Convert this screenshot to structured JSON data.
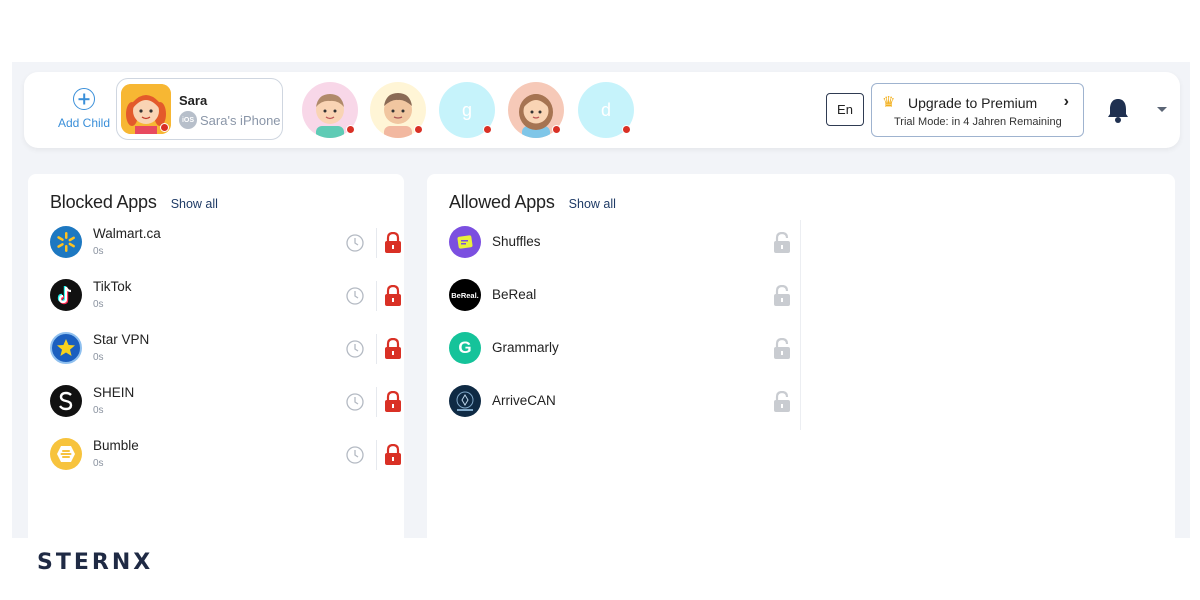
{
  "topbar": {
    "add_child_label": "Add Child",
    "active_child": {
      "name": "Sara",
      "device_badge": "iOS",
      "device": "Sara's iPhone"
    },
    "children": [
      {
        "initial": "",
        "color": "#f8d7e8",
        "kind": "boy"
      },
      {
        "initial": "",
        "color": "#fff5d6",
        "kind": "man"
      },
      {
        "initial": "g",
        "color": "#c6f3fb",
        "kind": "letter"
      },
      {
        "initial": "",
        "color": "#f6c9b8",
        "kind": "girl"
      },
      {
        "initial": "d",
        "color": "#c6f3fb",
        "kind": "letter"
      }
    ],
    "language": "En",
    "premium": {
      "title": "Upgrade to Premium",
      "subtitle": "Trial Mode: in 4 Jahren Remaining"
    }
  },
  "blocked": {
    "title": "Blocked Apps",
    "show_all": "Show all",
    "apps": [
      {
        "name": "Walmart.ca",
        "time": "0s",
        "icon": "walmart-icon"
      },
      {
        "name": "TikTok",
        "time": "0s",
        "icon": "tiktok-icon"
      },
      {
        "name": "Star VPN",
        "time": "0s",
        "icon": "star-vpn-icon"
      },
      {
        "name": "SHEIN",
        "time": "0s",
        "icon": "shein-icon"
      },
      {
        "name": "Bumble",
        "time": "0s",
        "icon": "bumble-icon"
      }
    ]
  },
  "allowed": {
    "title": "Allowed Apps",
    "show_all": "Show all",
    "apps": [
      {
        "name": "Shuffles",
        "icon": "shuffles-icon"
      },
      {
        "name": "BeReal",
        "icon": "bereal-icon",
        "icon_text": "BeReal."
      },
      {
        "name": "Grammarly",
        "icon": "grammarly-icon",
        "icon_text": "G"
      },
      {
        "name": "ArriveCAN",
        "icon": "arrivecan-icon"
      }
    ]
  },
  "colors": {
    "accent": "#3a8fd9",
    "lock_red": "#d93025",
    "status_dot": "#d93025",
    "lock_gray": "#c9ccd1"
  },
  "brand": "STERNX"
}
